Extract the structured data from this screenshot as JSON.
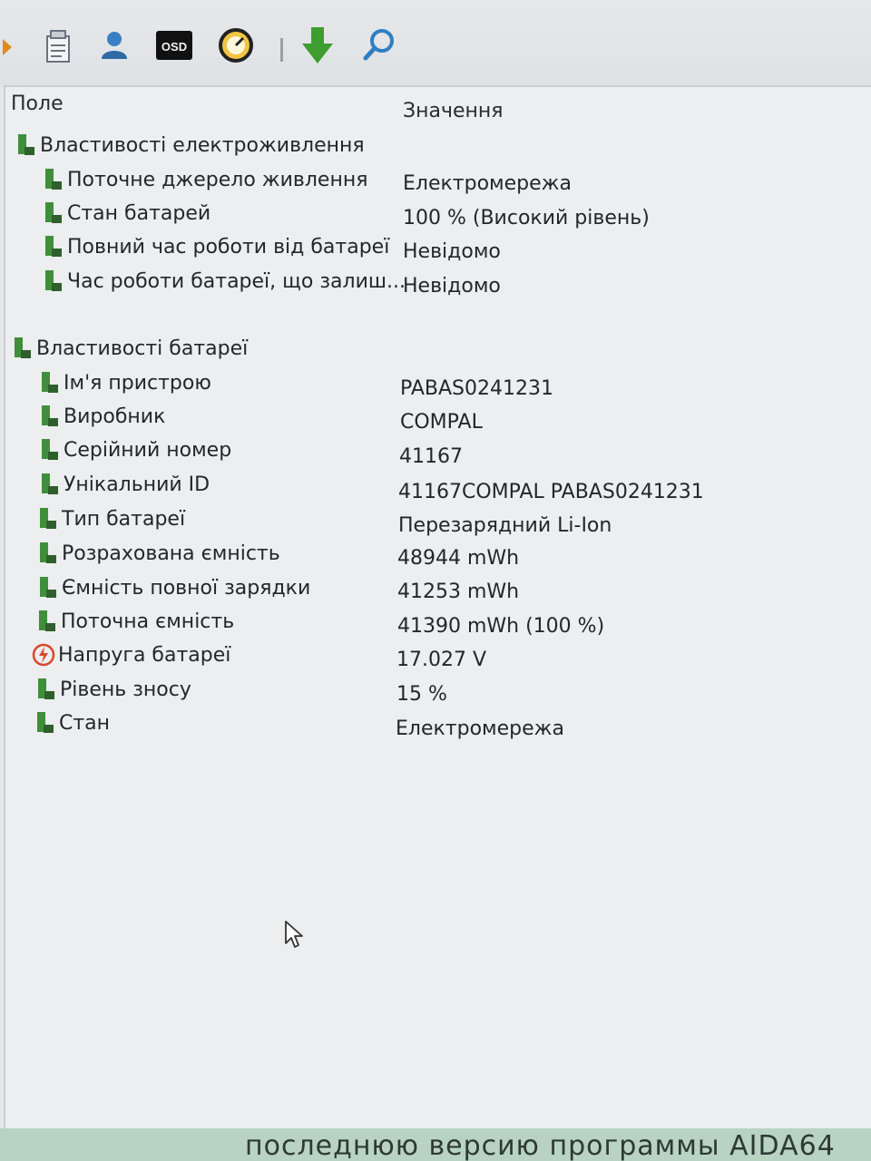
{
  "toolbar": {
    "buttons": [
      {
        "icon": "report-icon"
      },
      {
        "icon": "user-icon"
      },
      {
        "icon": "osd-icon",
        "label": "OSD"
      },
      {
        "icon": "gauge-icon"
      },
      {
        "icon": "download-icon"
      },
      {
        "icon": "search-icon"
      }
    ]
  },
  "table": {
    "headers": {
      "field": "Поле",
      "value": "Значення"
    }
  },
  "power": {
    "title": "Властивості електроживлення",
    "rows": [
      {
        "field": "Поточне джерело живлення",
        "value": "Електромережа"
      },
      {
        "field": "Стан батарей",
        "value": "100 % (Високий рівень)"
      },
      {
        "field": "Повний час роботи від батареї",
        "value": "Невідомо"
      },
      {
        "field": "Час роботи батареї, що залиш...",
        "value": "Невідомо"
      }
    ]
  },
  "battery": {
    "title": "Властивості батареї",
    "rows": [
      {
        "field": "Ім'я пристрою",
        "value": "PABAS0241231"
      },
      {
        "field": "Виробник",
        "value": "COMPAL"
      },
      {
        "field": "Серійний номер",
        "value": "41167"
      },
      {
        "field": "Унікальний ID",
        "value": "41167COMPAL PABAS0241231"
      },
      {
        "field": "Тип батареї",
        "value": "Перезарядний Li-Ion"
      },
      {
        "field": "Розрахована ємність",
        "value": "48944 mWh"
      },
      {
        "field": "Ємність повної зарядки",
        "value": "41253 mWh"
      },
      {
        "field": "Поточна ємність",
        "value": "41390 mWh  (100 %)"
      },
      {
        "field": "Напруга батареї",
        "value": "17.027 V"
      },
      {
        "field": "Рівень зносу",
        "value": "15 %"
      },
      {
        "field": "Стан",
        "value": "Електромережа"
      }
    ]
  },
  "footer": {
    "text": "последнюю версию программы AIDA64"
  },
  "colors": {
    "icon_green": "#3f8f3a",
    "icon_dark": "#2f5f2c",
    "bolt_red": "#d9472b"
  }
}
